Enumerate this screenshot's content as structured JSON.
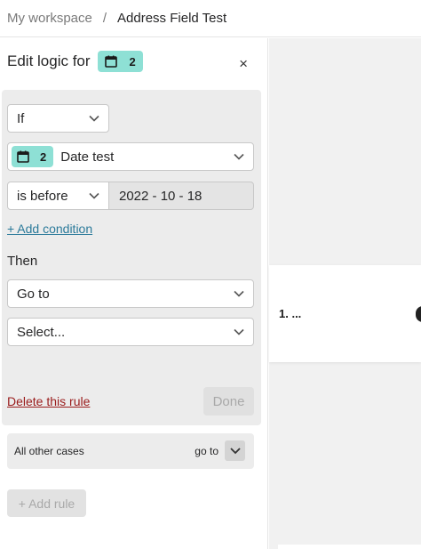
{
  "breadcrumb": {
    "workspace": "My workspace",
    "separator": "/",
    "form": "Address Field Test"
  },
  "panel": {
    "title": "Edit logic for",
    "question_badge_number": "2",
    "close_label": "×"
  },
  "rule": {
    "condition_type": "If",
    "field": {
      "number": "2",
      "label": "Date test",
      "icon": "calendar-icon"
    },
    "operator": "is before",
    "value": "2022 - 10 - 18",
    "add_condition": "+ Add condition",
    "then_label": "Then",
    "action": "Go to",
    "target_placeholder": "Select...",
    "delete_label": "Delete this rule",
    "done_label": "Done"
  },
  "other_cases": {
    "label": "All other cases",
    "goto_label": "go to"
  },
  "add_rule_label": "+ Add rule",
  "canvas": {
    "card_title": "1. ..."
  },
  "colors": {
    "badge": "#8ee0d5",
    "link": "#2b7a9a",
    "delete": "#9a1c1c"
  }
}
